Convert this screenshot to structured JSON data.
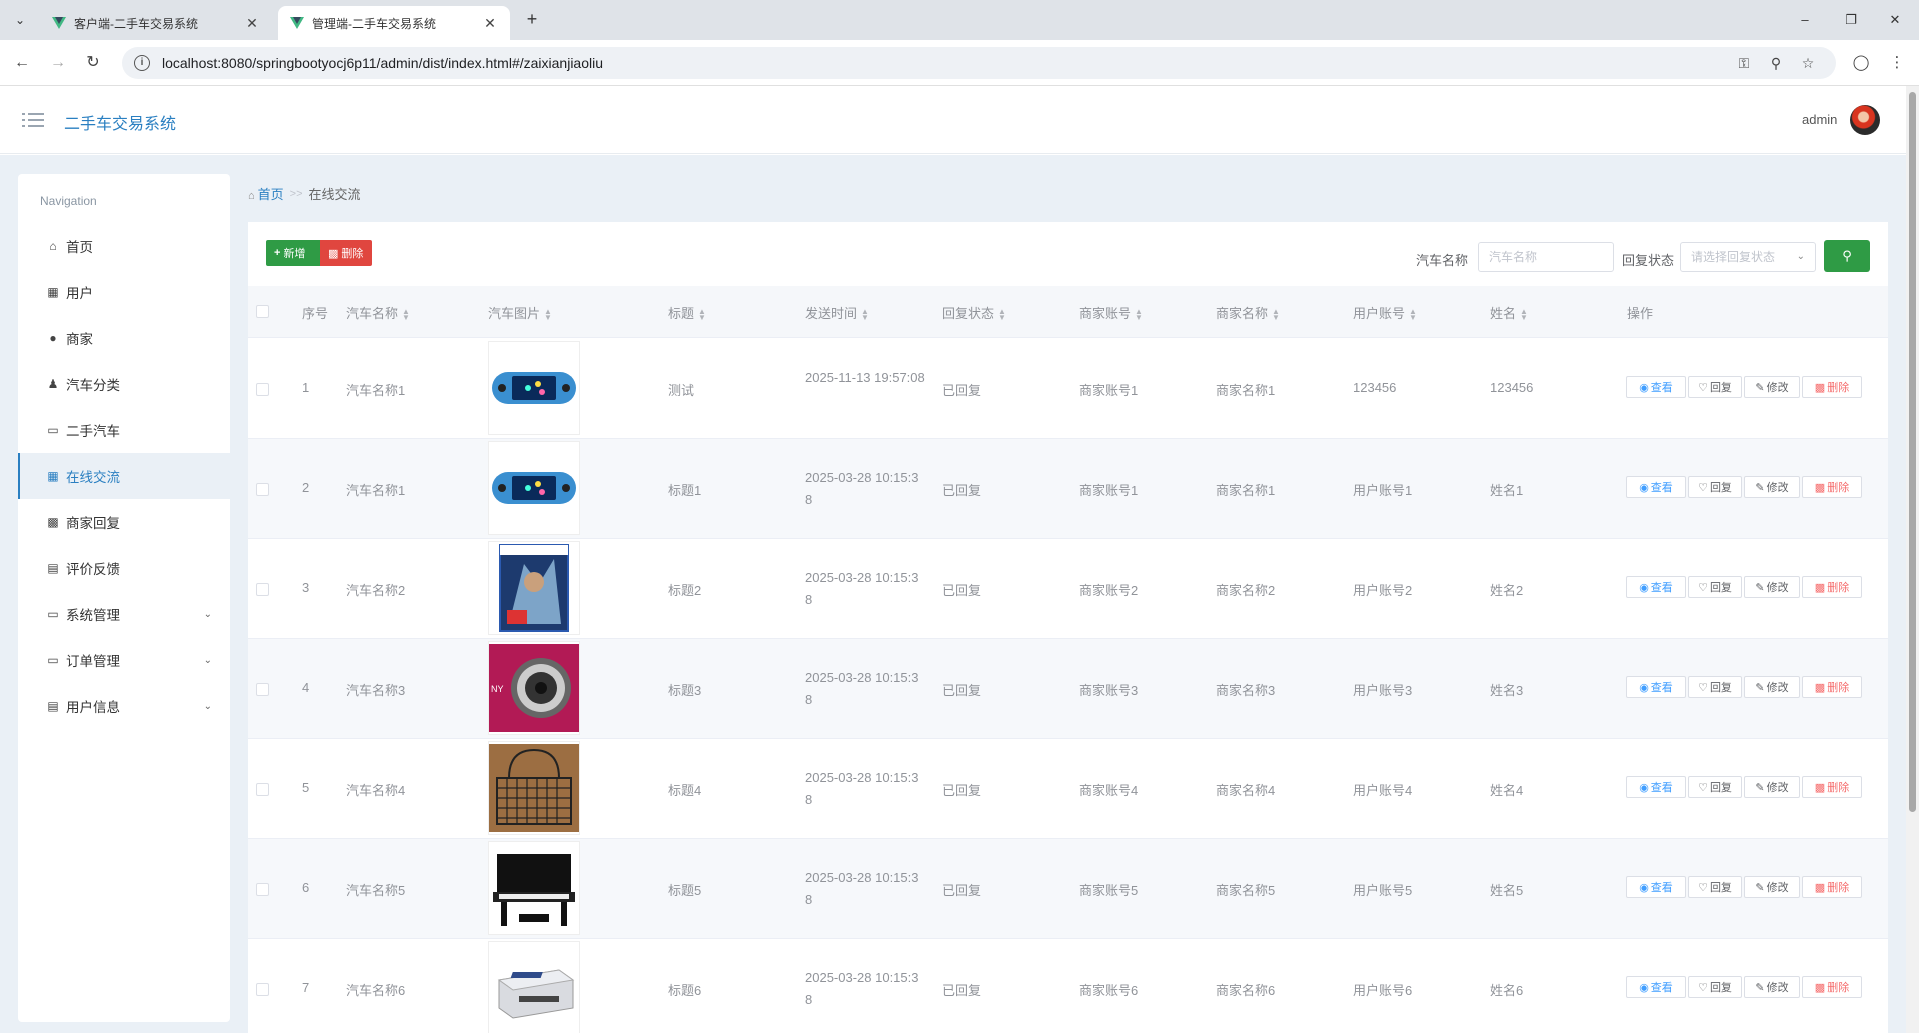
{
  "browser": {
    "tabs": [
      {
        "title": "客户端-二手车交易系统"
      },
      {
        "title": "管理端-二手车交易系统"
      }
    ],
    "url": "localhost:8080/springbootyocj6p11/admin/dist/index.html#/zaixianjiaoliu"
  },
  "header": {
    "app_title": "二手车交易系统",
    "user": "admin"
  },
  "sidebar": {
    "heading": "Navigation",
    "items": [
      {
        "label": "首页",
        "icon": "home-icon"
      },
      {
        "label": "用户",
        "icon": "briefcase-icon"
      },
      {
        "label": "商家",
        "icon": "globe-icon"
      },
      {
        "label": "汽车分类",
        "icon": "user-icon"
      },
      {
        "label": "二手汽车",
        "icon": "monitor-icon"
      },
      {
        "label": "在线交流",
        "icon": "grid-icon"
      },
      {
        "label": "商家回复",
        "icon": "chat-icon"
      },
      {
        "label": "评价反馈",
        "icon": "clipboard-icon"
      },
      {
        "label": "系统管理",
        "icon": "laptop-icon"
      },
      {
        "label": "订单管理",
        "icon": "desktop-icon"
      },
      {
        "label": "用户信息",
        "icon": "card-icon"
      }
    ]
  },
  "breadcrumb": {
    "home": "首页",
    "separator": ">>",
    "current": "在线交流"
  },
  "toolbar": {
    "add_label": "新增",
    "delete_label": "删除",
    "car_name_label": "汽车名称",
    "car_name_placeholder": "汽车名称",
    "reply_status_label": "回复状态",
    "reply_status_placeholder": "请选择回复状态"
  },
  "table": {
    "headers": {
      "index": "序号",
      "car_name": "汽车名称",
      "car_image": "汽车图片",
      "title": "标题",
      "send_time": "发送时间",
      "reply_status": "回复状态",
      "merchant_account": "商家账号",
      "merchant_name": "商家名称",
      "user_account": "用户账号",
      "name": "姓名",
      "actions": "操作"
    },
    "actions": {
      "view": "查看",
      "reply": "回复",
      "edit": "修改",
      "delete": "删除"
    },
    "rows": [
      {
        "index": "1",
        "car_name": "汽车名称1",
        "image": "game-console",
        "title": "测试",
        "send_time": "2025-11-13 19:57:08",
        "reply_status": "已回复",
        "merchant_account": "商家账号1",
        "merchant_name": "商家名称1",
        "user_account": "123456",
        "name": "123456"
      },
      {
        "index": "2",
        "car_name": "汽车名称1",
        "image": "game-console",
        "title": "标题1",
        "send_time": "2025-03-28 10:15:38",
        "reply_status": "已回复",
        "merchant_account": "商家账号1",
        "merchant_name": "商家名称1",
        "user_account": "用户账号1",
        "name": "姓名1"
      },
      {
        "index": "3",
        "car_name": "汽车名称2",
        "image": "game-case",
        "title": "标题2",
        "send_time": "2025-03-28 10:15:38",
        "reply_status": "已回复",
        "merchant_account": "商家账号2",
        "merchant_name": "商家名称2",
        "user_account": "用户账号2",
        "name": "姓名2"
      },
      {
        "index": "4",
        "car_name": "汽车名称3",
        "image": "camera",
        "title": "标题3",
        "send_time": "2025-03-28 10:15:38",
        "reply_status": "已回复",
        "merchant_account": "商家账号3",
        "merchant_name": "商家名称3",
        "user_account": "用户账号3",
        "name": "姓名3"
      },
      {
        "index": "5",
        "car_name": "汽车名称4",
        "image": "wire-basket",
        "title": "标题4",
        "send_time": "2025-03-28 10:15:38",
        "reply_status": "已回复",
        "merchant_account": "商家账号4",
        "merchant_name": "商家名称4",
        "user_account": "用户账号4",
        "name": "姓名4"
      },
      {
        "index": "6",
        "car_name": "汽车名称5",
        "image": "piano",
        "title": "标题5",
        "send_time": "2025-03-28 10:15:38",
        "reply_status": "已回复",
        "merchant_account": "商家账号5",
        "merchant_name": "商家名称5",
        "user_account": "用户账号5",
        "name": "姓名5"
      },
      {
        "index": "7",
        "car_name": "汽车名称6",
        "image": "printer",
        "title": "标题6",
        "send_time": "2025-03-28 10:15:38",
        "reply_status": "已回复",
        "merchant_account": "商家账号6",
        "merchant_name": "商家名称6",
        "user_account": "用户账号6",
        "name": "姓名6"
      }
    ]
  },
  "colors": {
    "primary_blue": "#2a7fc1",
    "add_green": "#2f9b45",
    "delete_red": "#e0463f",
    "page_bg": "#eaf0f6"
  }
}
